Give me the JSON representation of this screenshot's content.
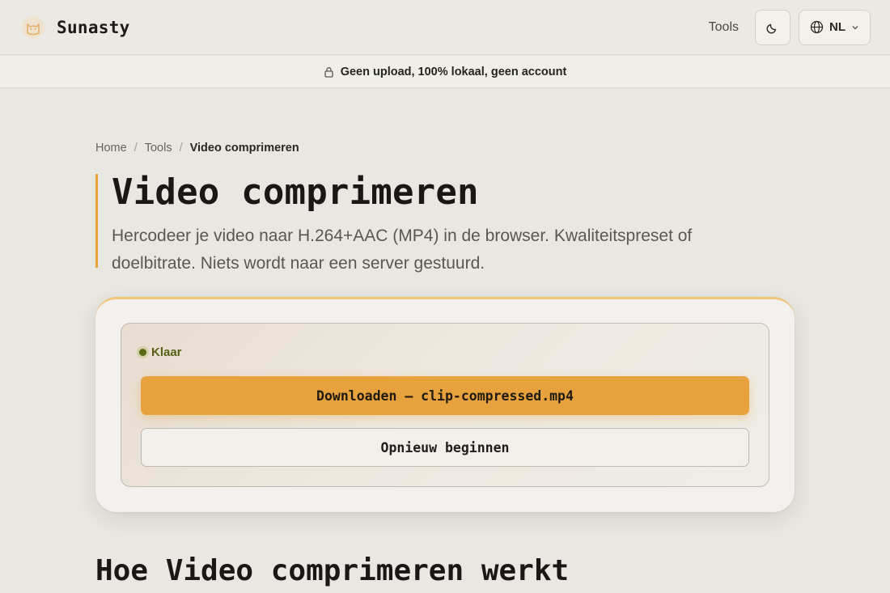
{
  "brand": {
    "name": "Sunasty",
    "logo_icon": "cat-icon"
  },
  "nav": {
    "tools_label": "Tools",
    "theme_icon": "moon-icon",
    "language_icon": "globe-icon",
    "language_code": "NL"
  },
  "banner": {
    "icon": "lock-icon",
    "text": "Geen upload, 100% lokaal, geen account"
  },
  "breadcrumb": {
    "items": [
      "Home",
      "Tools",
      "Video comprimeren"
    ],
    "separator": "/"
  },
  "hero": {
    "title": "Video comprimeren",
    "description": "Hercodeer je video naar H.264+AAC (MP4) in de browser. Kwaliteitspreset of doelbitrate. Niets wordt naar een server gestuurd."
  },
  "result": {
    "status_label": "Klaar",
    "download_label": "Downloaden — clip-compressed.mp4",
    "restart_label": "Opnieuw beginnen"
  },
  "how_it_works": {
    "title": "Hoe Video comprimeren werkt"
  },
  "colors": {
    "accent": "#e8a23d",
    "status_ok": "#5a6a16",
    "background": "#e9e7e2"
  }
}
